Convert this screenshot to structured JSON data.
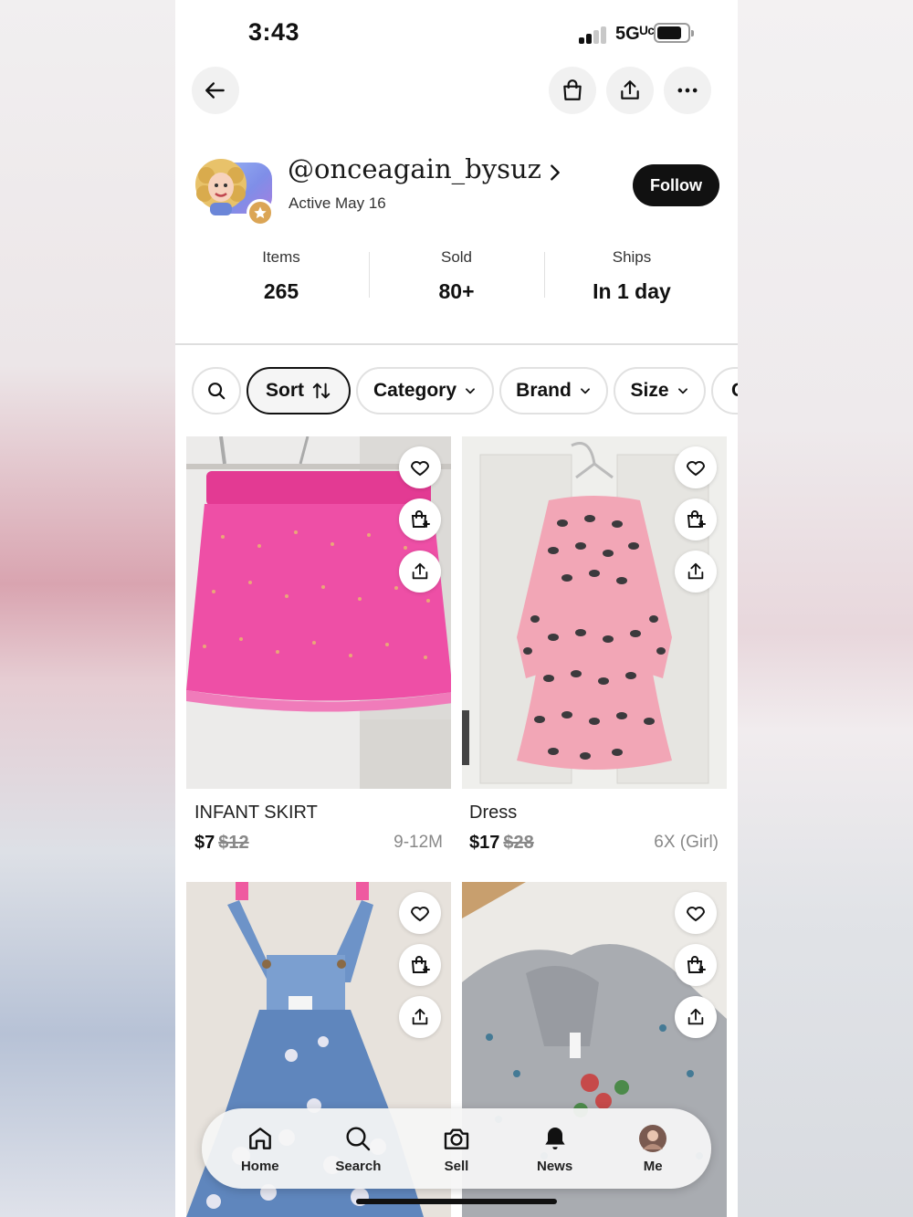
{
  "status_bar": {
    "time": "3:43",
    "network": "5Gᵁᶜ"
  },
  "top_nav": {
    "back_icon": "arrow-left-icon",
    "bag_icon": "shopping-bag-icon",
    "share_icon": "share-icon",
    "more_icon": "more-horizontal-icon"
  },
  "profile": {
    "username": "@onceagain_bysuz",
    "active": "Active May 16",
    "follow_label": "Follow"
  },
  "stats": [
    {
      "label": "Items",
      "value": "265"
    },
    {
      "label": "Sold",
      "value": "80+"
    },
    {
      "label": "Ships",
      "value": "In 1 day"
    }
  ],
  "filters": {
    "search_icon": "search-icon",
    "chips": [
      {
        "label": "Sort"
      },
      {
        "label": "Category"
      },
      {
        "label": "Brand"
      },
      {
        "label": "Size"
      },
      {
        "label": "C"
      }
    ]
  },
  "listings": [
    {
      "title": "INFANT SKIRT",
      "price": "$7",
      "original_price": "$12",
      "size": "9-12M"
    },
    {
      "title": "Dress",
      "price": "$17",
      "original_price": "$28",
      "size": "6X (Girl)"
    }
  ],
  "bottom_nav": {
    "items": [
      {
        "label": "Home",
        "icon": "home-icon"
      },
      {
        "label": "Search",
        "icon": "search-icon"
      },
      {
        "label": "Sell",
        "icon": "camera-icon"
      },
      {
        "label": "News",
        "icon": "bell-icon"
      },
      {
        "label": "Me",
        "icon": "avatar"
      }
    ]
  },
  "colors": {
    "follow_bg": "#111111",
    "skirt": "#ee3f9f",
    "dress": "#f2a6b6",
    "denim": "#5f86bd",
    "badge": "#dba555"
  }
}
